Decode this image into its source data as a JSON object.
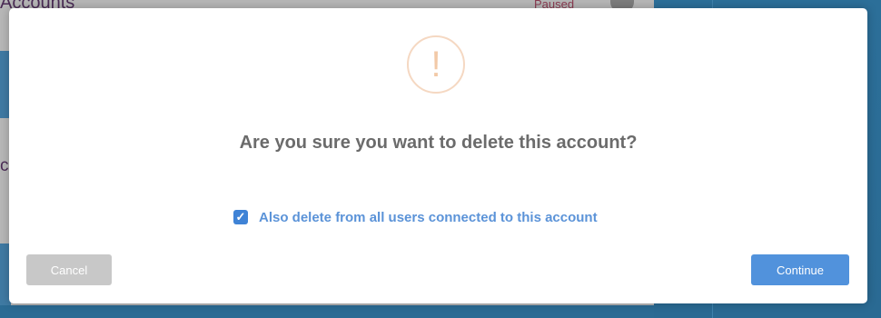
{
  "background": {
    "title": "Accounts",
    "left_letter": "c",
    "status": "Paused"
  },
  "dialog": {
    "icon": "exclamation-icon",
    "icon_glyph": "!",
    "question": "Are you sure you want to delete this account?",
    "checkbox": {
      "checked": true,
      "label": "Also delete from all users connected to this account"
    },
    "cancel_label": "Cancel",
    "continue_label": "Continue"
  },
  "colors": {
    "primary": "#5192dc",
    "checkbox": "#3f83d6",
    "link_text": "#5b93d8",
    "warning": "#f2c9a7",
    "cancel": "#c8c8c8"
  }
}
